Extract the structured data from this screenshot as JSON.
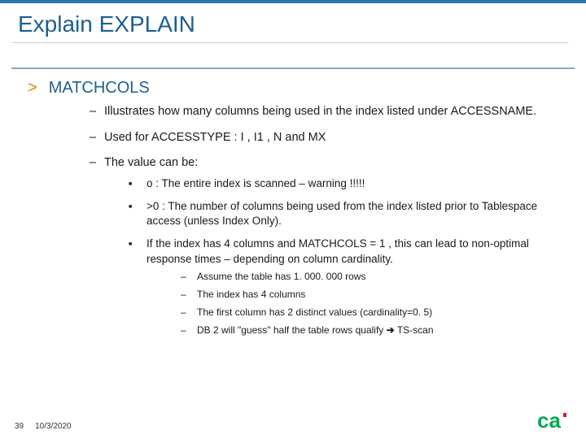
{
  "title": "Explain EXPLAIN",
  "section": "MATCHCOLS",
  "bullets": {
    "b1": "Illustrates how many columns being used in the index listed under ACCESSNAME.",
    "b2": "Used for ACCESSTYPE : I , I1 , N and MX",
    "b3_intro": "The value can be:",
    "sq1": "o   : The entire index is scanned – warning !!!!!",
    "sq2": ">0 : The number of columns being used from the index listed prior to Tablespace access (unless Index Only).",
    "sq3": "If the index has 4 columns and MATCHCOLS = 1 , this can lead to non-optimal response times – depending on column cardinality.",
    "sub1": "Assume the table has 1. 000. 000 rows",
    "sub2": "The index has 4 columns",
    "sub3": "The first column has 2 distinct values (cardinality=0. 5)",
    "sub4_pre": "DB 2 will \"guess\" half the table rows qualify ",
    "sub4_post": " TS-scan"
  },
  "footer": {
    "page": "39",
    "date": "10/3/2020"
  },
  "glyphs": {
    "gt": ">",
    "dash": "–",
    "square": "■",
    "arrow": "➔"
  },
  "logo": {
    "text": "ca",
    "fill": "#00a94f",
    "accent": "#e31b23"
  }
}
